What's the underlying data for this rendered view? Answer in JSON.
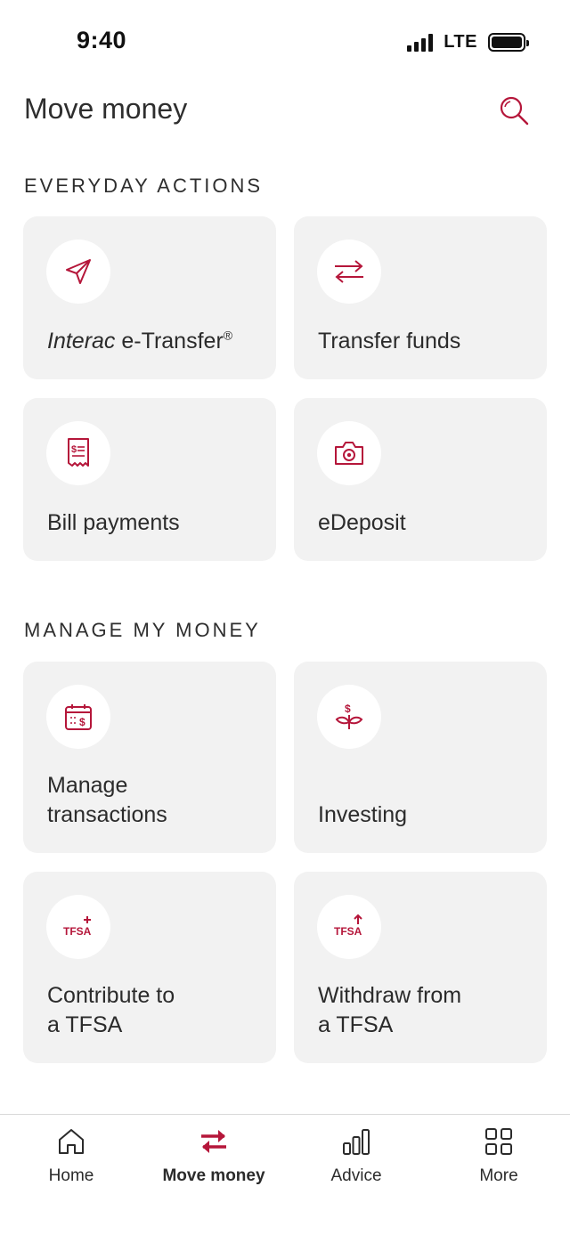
{
  "status": {
    "time": "9:40",
    "network": "LTE"
  },
  "header": {
    "title": "Move money"
  },
  "sections": {
    "everyday": {
      "title": "EVERYDAY ACTIONS"
    },
    "manage": {
      "title": "MANAGE MY MONEY"
    }
  },
  "cards": {
    "interac": {
      "label_italic": "Interac",
      "label_rest": " e-Transfer",
      "label_mark": "®",
      "icon": "send-icon"
    },
    "transfer": {
      "label": "Transfer funds",
      "icon": "transfer-arrows-icon"
    },
    "bills": {
      "label": "Bill payments",
      "icon": "receipt-icon"
    },
    "edeposit": {
      "label": "eDeposit",
      "icon": "camera-icon"
    },
    "manage_tx": {
      "label_line1": "Manage",
      "label_line2": "transactions",
      "icon": "calendar-dollar-icon"
    },
    "investing": {
      "label": "Investing",
      "icon": "plant-dollar-icon"
    },
    "contribute": {
      "label_line1": "Contribute to",
      "label_line2": "a TFSA",
      "icon_text": "TFSA",
      "icon": "tfsa-plus-icon"
    },
    "withdraw": {
      "label_line1": "Withdraw from",
      "label_line2": "a TFSA",
      "icon_text": "TFSA",
      "icon": "tfsa-arrow-up-icon"
    }
  },
  "tabs": [
    {
      "label": "Home",
      "icon": "home-icon"
    },
    {
      "label": "Move money",
      "icon": "transfer-arrows-icon",
      "active": true
    },
    {
      "label": "Advice",
      "icon": "bar-chart-icon"
    },
    {
      "label": "More",
      "icon": "grid-icon"
    }
  ],
  "colors": {
    "accent": "#b5163a",
    "card_bg": "#f2f2f2",
    "text": "#2b2b2b"
  }
}
